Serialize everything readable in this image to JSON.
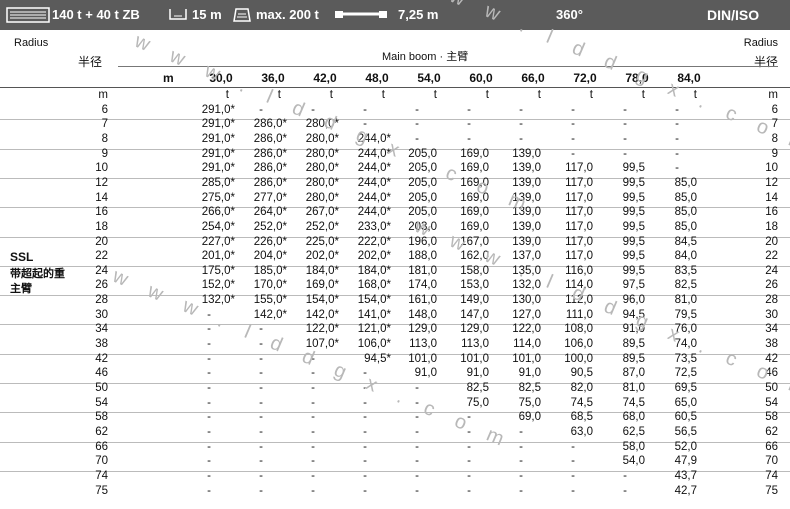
{
  "header": {
    "counterweight": "140 t + 40 t ZB",
    "jib_length": "15 m",
    "max_capacity": "max. 200 t",
    "width": "7,25 m",
    "rotation": "360°",
    "standard": "DIN/ISO"
  },
  "labels": {
    "radius_en": "Radius",
    "radius_zh": "半径",
    "main_boom": "Main boom · 主臂",
    "m": "m",
    "ssl_en": "SSL",
    "ssl_zh_1": "带超起的重",
    "ssl_zh_2": "主臂"
  },
  "watermark": "w w w . l d d g x . c o m",
  "boom_lengths": [
    "30,0",
    "36,0",
    "42,0",
    "48,0",
    "54,0",
    "60,0",
    "66,0",
    "72,0",
    "78,0",
    "84,0"
  ],
  "rows": [
    {
      "r": "m",
      "v": [
        "t",
        "t",
        "t",
        "t",
        "t",
        "t",
        "t",
        "t",
        "t",
        "t"
      ],
      "rr": "m"
    },
    {
      "r": "6",
      "v": [
        "291,0*",
        "-",
        "-",
        "-",
        "-",
        "-",
        "-",
        "-",
        "-",
        "-"
      ],
      "rr": "6"
    },
    {
      "r": "7",
      "v": [
        "291,0*",
        "286,0*",
        "280,0*",
        "-",
        "-",
        "-",
        "-",
        "-",
        "-",
        "-"
      ],
      "rr": "7"
    },
    {
      "r": "8",
      "v": [
        "291,0*",
        "286,0*",
        "280,0*",
        "244,0*",
        "-",
        "-",
        "-",
        "-",
        "-",
        "-"
      ],
      "rr": "8"
    },
    {
      "r": "9",
      "v": [
        "291,0*",
        "286,0*",
        "280,0*",
        "244,0*",
        "205,0",
        "169,0",
        "139,0",
        "-",
        "-",
        "-"
      ],
      "rr": "9"
    },
    {
      "r": "10",
      "v": [
        "291,0*",
        "286,0*",
        "280,0*",
        "244,0*",
        "205,0",
        "169,0",
        "139,0",
        "117,0",
        "99,5",
        "-"
      ],
      "rr": "10"
    },
    {
      "r": "12",
      "v": [
        "285,0*",
        "286,0*",
        "280,0*",
        "244,0*",
        "205,0",
        "169,0",
        "139,0",
        "117,0",
        "99,5",
        "85,0"
      ],
      "rr": "12"
    },
    {
      "r": "14",
      "v": [
        "275,0*",
        "277,0*",
        "280,0*",
        "244,0*",
        "205,0",
        "169,0",
        "139,0",
        "117,0",
        "99,5",
        "85,0"
      ],
      "rr": "14"
    },
    {
      "r": "16",
      "v": [
        "266,0*",
        "264,0*",
        "267,0*",
        "244,0*",
        "205,0",
        "169,0",
        "139,0",
        "117,0",
        "99,5",
        "85,0"
      ],
      "rr": "16"
    },
    {
      "r": "18",
      "v": [
        "254,0*",
        "252,0*",
        "252,0*",
        "233,0*",
        "203,0",
        "169,0",
        "139,0",
        "117,0",
        "99,5",
        "85,0"
      ],
      "rr": "18"
    },
    {
      "r": "20",
      "v": [
        "227,0*",
        "226,0*",
        "225,0*",
        "222,0*",
        "196,0",
        "167,0",
        "139,0",
        "117,0",
        "99,5",
        "84,5"
      ],
      "rr": "20"
    },
    {
      "r": "22",
      "v": [
        "201,0*",
        "204,0*",
        "202,0*",
        "202,0*",
        "188,0",
        "162,0",
        "137,0",
        "117,0",
        "99,5",
        "84,0"
      ],
      "rr": "22"
    },
    {
      "r": "24",
      "v": [
        "175,0*",
        "185,0*",
        "184,0*",
        "184,0*",
        "181,0",
        "158,0",
        "135,0",
        "116,0",
        "99,5",
        "83,5"
      ],
      "rr": "24"
    },
    {
      "r": "26",
      "v": [
        "152,0*",
        "170,0*",
        "169,0*",
        "168,0*",
        "174,0",
        "153,0",
        "132,0",
        "114,0",
        "97,5",
        "82,5"
      ],
      "rr": "26"
    },
    {
      "r": "28",
      "v": [
        "132,0*",
        "155,0*",
        "154,0*",
        "154,0*",
        "161,0",
        "149,0",
        "130,0",
        "112,0",
        "96,0",
        "81,0"
      ],
      "rr": "28"
    },
    {
      "r": "30",
      "v": [
        "-",
        "142,0*",
        "142,0*",
        "141,0*",
        "148,0",
        "147,0",
        "127,0",
        "111,0",
        "94,5",
        "79,5"
      ],
      "rr": "30"
    },
    {
      "r": "34",
      "v": [
        "-",
        "-",
        "122,0*",
        "121,0*",
        "129,0",
        "129,0",
        "122,0",
        "108,0",
        "91,0",
        "76,0"
      ],
      "rr": "34"
    },
    {
      "r": "38",
      "v": [
        "-",
        "-",
        "107,0*",
        "106,0*",
        "113,0",
        "113,0",
        "114,0",
        "106,0",
        "89,5",
        "74,0"
      ],
      "rr": "38"
    },
    {
      "r": "42",
      "v": [
        "-",
        "-",
        "-",
        "94,5*",
        "101,0",
        "101,0",
        "101,0",
        "100,0",
        "89,5",
        "73,5"
      ],
      "rr": "42"
    },
    {
      "r": "46",
      "v": [
        "-",
        "-",
        "-",
        "-",
        "91,0",
        "91,0",
        "91,0",
        "90,5",
        "87,0",
        "72,5"
      ],
      "rr": "46"
    },
    {
      "r": "50",
      "v": [
        "-",
        "-",
        "-",
        "-",
        "-",
        "82,5",
        "82,5",
        "82,0",
        "81,0",
        "69,5"
      ],
      "rr": "50"
    },
    {
      "r": "54",
      "v": [
        "-",
        "-",
        "-",
        "-",
        "-",
        "75,0",
        "75,0",
        "74,5",
        "74,5",
        "65,0"
      ],
      "rr": "54"
    },
    {
      "r": "58",
      "v": [
        "-",
        "-",
        "-",
        "-",
        "-",
        "-",
        "69,0",
        "68,5",
        "68,0",
        "60,5"
      ],
      "rr": "58"
    },
    {
      "r": "62",
      "v": [
        "-",
        "-",
        "-",
        "-",
        "-",
        "-",
        "-",
        "63,0",
        "62,5",
        "56,5"
      ],
      "rr": "62"
    },
    {
      "r": "66",
      "v": [
        "-",
        "-",
        "-",
        "-",
        "-",
        "-",
        "-",
        "-",
        "58,0",
        "52,0"
      ],
      "rr": "66"
    },
    {
      "r": "70",
      "v": [
        "-",
        "-",
        "-",
        "-",
        "-",
        "-",
        "-",
        "-",
        "54,0",
        "47,9"
      ],
      "rr": "70"
    },
    {
      "r": "74",
      "v": [
        "-",
        "-",
        "-",
        "-",
        "-",
        "-",
        "-",
        "-",
        "-",
        "43,7"
      ],
      "rr": "74"
    },
    {
      "r": "75",
      "v": [
        "-",
        "-",
        "-",
        "-",
        "-",
        "-",
        "-",
        "-",
        "-",
        "42,7"
      ],
      "rr": "75"
    }
  ]
}
